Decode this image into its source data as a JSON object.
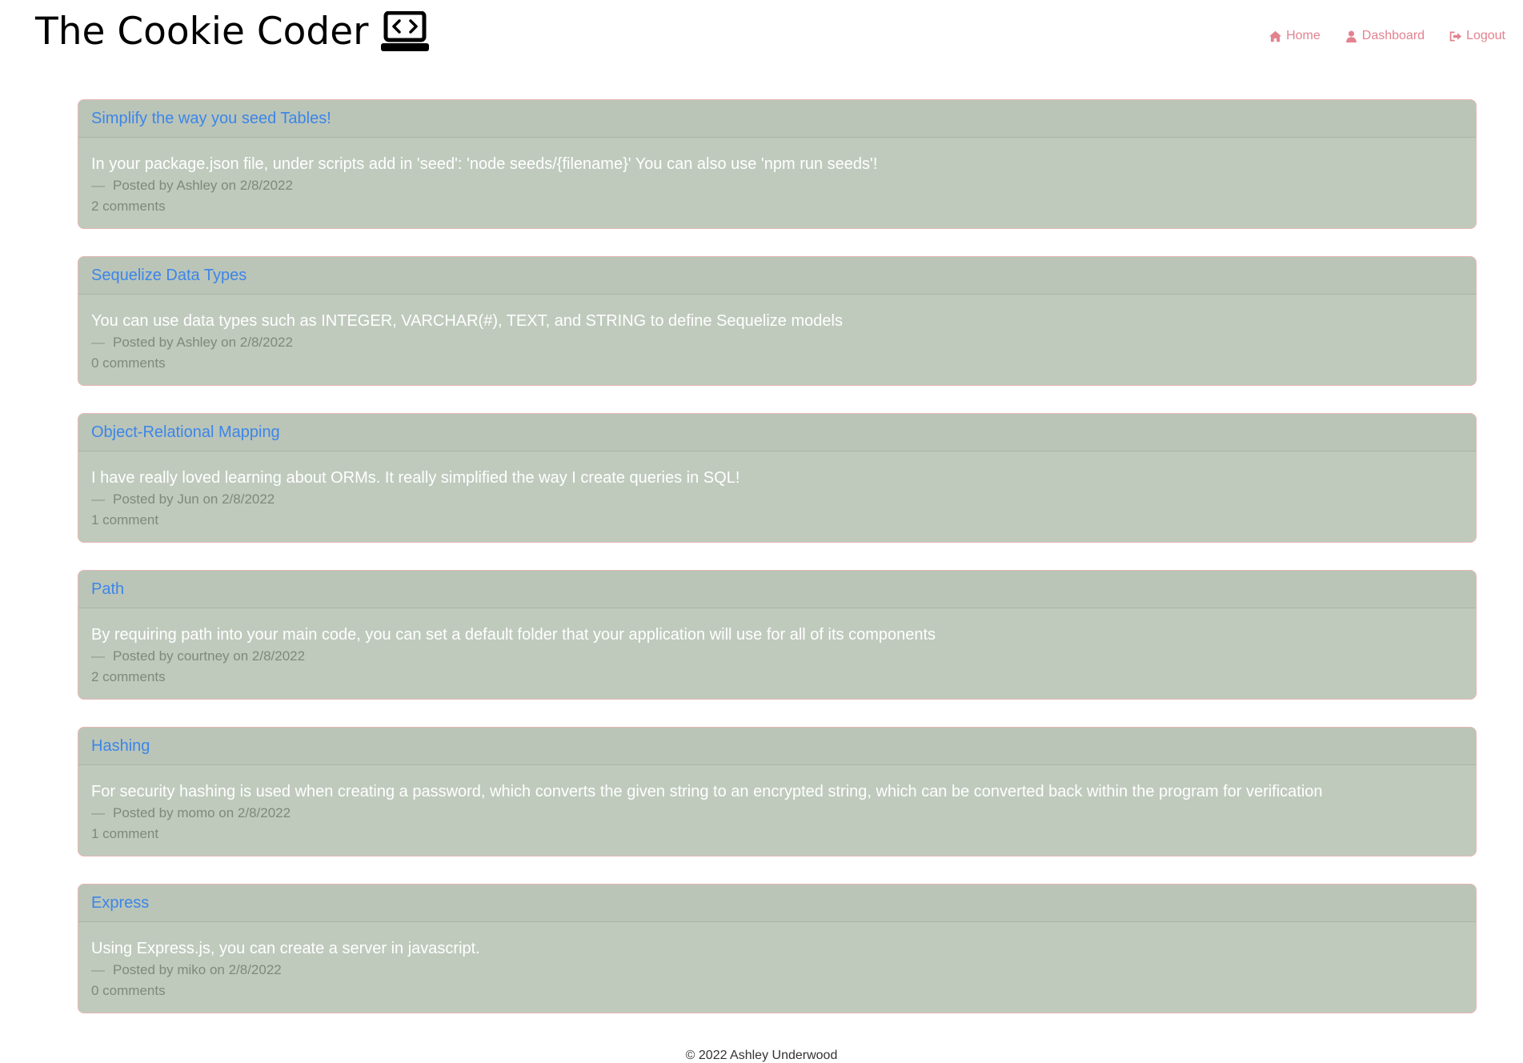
{
  "header": {
    "site_title": "The Cookie Coder",
    "logo_icon": "laptop-code-icon",
    "nav": [
      {
        "label": "Home",
        "icon": "home-icon"
      },
      {
        "label": "Dashboard",
        "icon": "user-icon"
      },
      {
        "label": "Logout",
        "icon": "sign-out-icon"
      }
    ]
  },
  "colors": {
    "accent_pink": "#e3828f",
    "card_bg": "#bfcabd",
    "link_blue": "#3d85e8"
  },
  "posts": [
    {
      "title": "Simplify the way you seed Tables!",
      "content": "In your package.json file, under scripts add in 'seed': 'node seeds/{filename}' You can also use 'npm run seeds'!",
      "meta_dash": "—",
      "meta": "Posted by Ashley on 2/8/2022",
      "comments": "2 comments"
    },
    {
      "title": "Sequelize Data Types",
      "content": "You can use data types such as INTEGER, VARCHAR(#), TEXT, and STRING to define Sequelize models",
      "meta_dash": "—",
      "meta": "Posted by Ashley on 2/8/2022",
      "comments": "0 comments"
    },
    {
      "title": "Object-Relational Mapping",
      "content": "I have really loved learning about ORMs. It really simplified the way I create queries in SQL!",
      "meta_dash": "—",
      "meta": "Posted by Jun on 2/8/2022",
      "comments": "1 comment"
    },
    {
      "title": "Path",
      "content": "By requiring path into your main code, you can set a default folder that your application will use for all of its components",
      "meta_dash": "—",
      "meta": "Posted by courtney on 2/8/2022",
      "comments": "2 comments"
    },
    {
      "title": "Hashing",
      "content": "For security hashing is used when creating a password, which converts the given string to an encrypted string, which can be converted back within the program for verification",
      "meta_dash": "—",
      "meta": "Posted by momo on 2/8/2022",
      "comments": "1 comment"
    },
    {
      "title": "Express",
      "content": "Using Express.js, you can create a server in javascript.",
      "meta_dash": "—",
      "meta": "Posted by miko on 2/8/2022",
      "comments": "0 comments"
    }
  ],
  "footer": {
    "text": "© 2022 Ashley Underwood"
  }
}
